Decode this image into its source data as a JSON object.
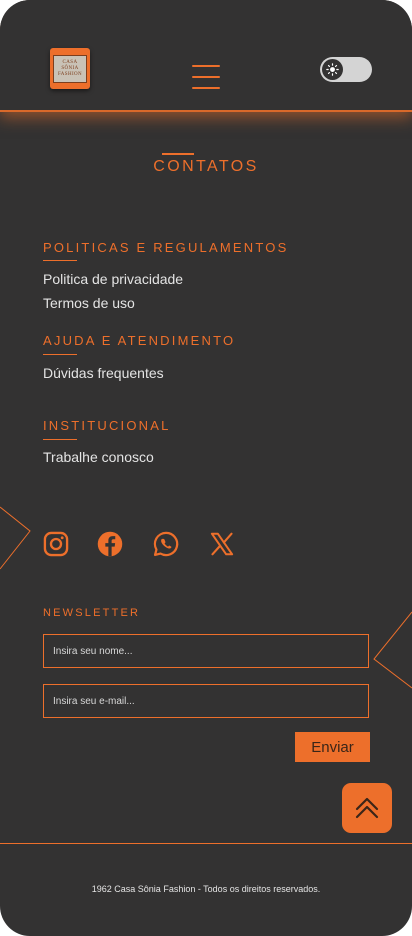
{
  "header": {
    "logo_text": [
      "CASA",
      "SÔNIA",
      "FASHION"
    ],
    "menu_icon": "hamburger-icon",
    "theme_toggle_icon": "sun-icon"
  },
  "contacts": {
    "title": "CONTATOS"
  },
  "sections": [
    {
      "title": "POLITICAS E REGULAMENTOS",
      "links": [
        "Politica de privacidade",
        "Termos de uso"
      ]
    },
    {
      "title": "AJUDA E ATENDIMENTO",
      "links": [
        "Dúvidas frequentes"
      ]
    },
    {
      "title": "INSTITUCIONAL",
      "links": [
        "Trabalhe conosco"
      ]
    }
  ],
  "social": [
    "instagram-icon",
    "facebook-icon",
    "whatsapp-icon",
    "x-icon"
  ],
  "newsletter": {
    "title": "NEWSLETTER",
    "name_placeholder": "Insira seu nome...",
    "email_placeholder": "Insira seu e-mail...",
    "submit_label": "Enviar"
  },
  "back_to_top_icon": "double-chevron-up-icon",
  "footer": {
    "copyright": "1962 Casa Sônia Fashion - Todos os direitos reservados."
  },
  "colors": {
    "background": "#333232",
    "accent": "#ed6f2b",
    "text": "#e4e4e4"
  }
}
